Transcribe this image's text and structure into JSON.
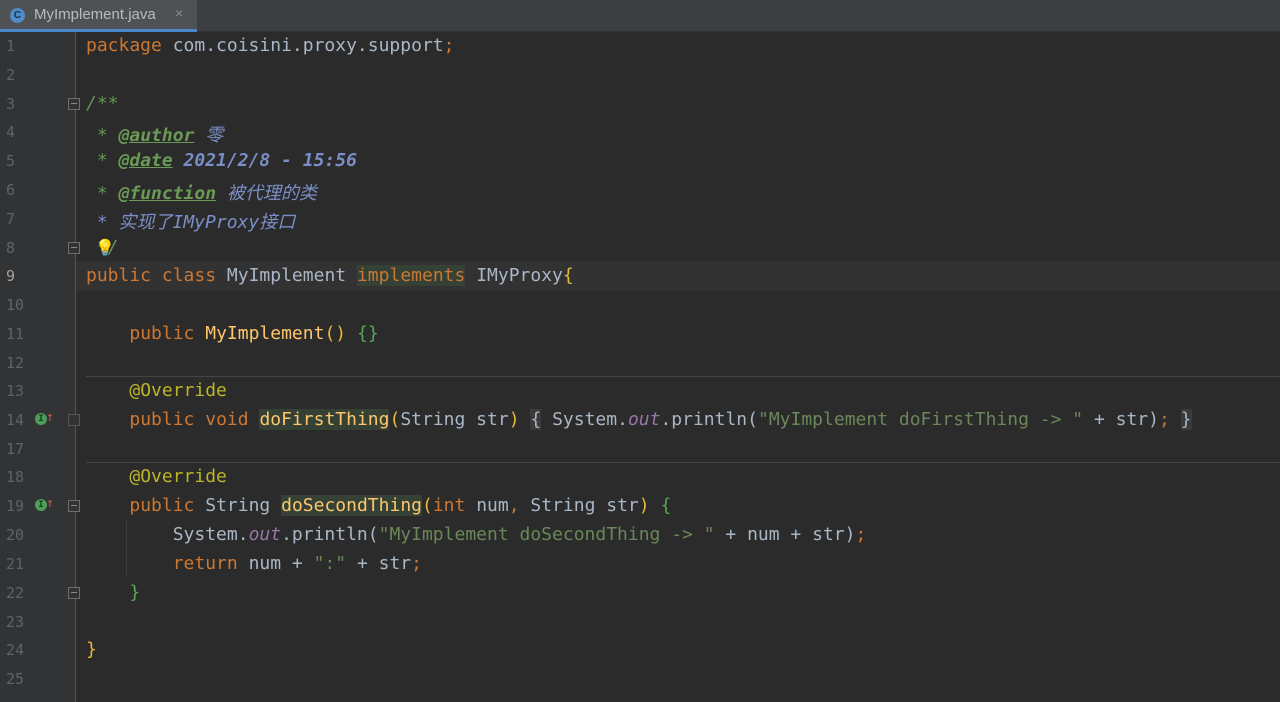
{
  "tab": {
    "icon_letter": "C",
    "title": "MyImplement.java",
    "close": "×"
  },
  "lines": {
    "n1": "1",
    "n2": "2",
    "n3": "3",
    "n4": "4",
    "n5": "5",
    "n6": "6",
    "n7": "7",
    "n8": "8",
    "n9": "9",
    "n10": "10",
    "n11": "11",
    "n12": "12",
    "n13": "13",
    "n14": "14",
    "n17": "17",
    "n18": "18",
    "n19": "19",
    "n20": "20",
    "n21": "21",
    "n22": "22",
    "n23": "23",
    "n24": "24",
    "n25": "25"
  },
  "code": {
    "l1_kw": "package",
    "l1_rest": " com.coisini.proxy.support",
    "l1_semi": ";",
    "l3": "/**",
    "l4_star": " * ",
    "l4_tag": "@author",
    "l4_val": " 零",
    "l5_star": " * ",
    "l5_tag": "@date",
    "l5_val": " 2021/2/8 - 15:56",
    "l6_star": " * ",
    "l6_tag": "@function",
    "l6_val": " 被代理的类",
    "l7": " * 实现了IMyProxy接口",
    "l8": " */",
    "l9_kw1": "public",
    "l9_kw2": "class",
    "l9_name": "MyImplement",
    "l9_impl": "implements",
    "l9_iface": "IMyProxy",
    "l9_brace": "{",
    "l11_kw": "public",
    "l11_name": "MyImplement",
    "l11_parens": "()",
    "l11_braces": "{}",
    "l13": "@Override",
    "l14_kw1": "public",
    "l14_kw2": "void",
    "l14_name": "doFirstThing",
    "l14_params_open": "(",
    "l14_params": "String str",
    "l14_params_close": ")",
    "l14_ob": "{",
    "l14_sys": "System.",
    "l14_out": "out",
    "l14_println": ".println(",
    "l14_str": "\"MyImplement doFirstThing -> \"",
    "l14_plus": " + str)",
    "l14_semi": ";",
    "l14_cb": "}",
    "l18": "@Override",
    "l19_kw1": "public",
    "l19_type": "String",
    "l19_name": "doSecondThing",
    "l19_open": "(",
    "l19_int": "int",
    "l19_p1": " num",
    "l19_comma": ",",
    "l19_p2": " String str",
    "l19_close": ")",
    "l19_brace": "{",
    "l20_sys": "System.",
    "l20_out": "out",
    "l20_println": ".println(",
    "l20_str": "\"MyImplement doSecondThing -> \"",
    "l20_rest": " + num + str)",
    "l20_semi": ";",
    "l21_kw": "return",
    "l21_a": " num + ",
    "l21_str": "\":\"",
    "l21_b": " + str",
    "l21_semi": ";",
    "l22": "}",
    "l24": "}"
  },
  "colors": {
    "background": "#2b2b2b",
    "keyword": "#cc7832",
    "annotation": "#bbb529",
    "method": "#ffc66d",
    "string": "#6a8759",
    "javadoc": "#629755",
    "tab_underline": "#4a88c7"
  },
  "icons": {
    "tab": "java-class-icon",
    "intention": "lightbulb-icon",
    "implements": "implements-method-icon"
  }
}
